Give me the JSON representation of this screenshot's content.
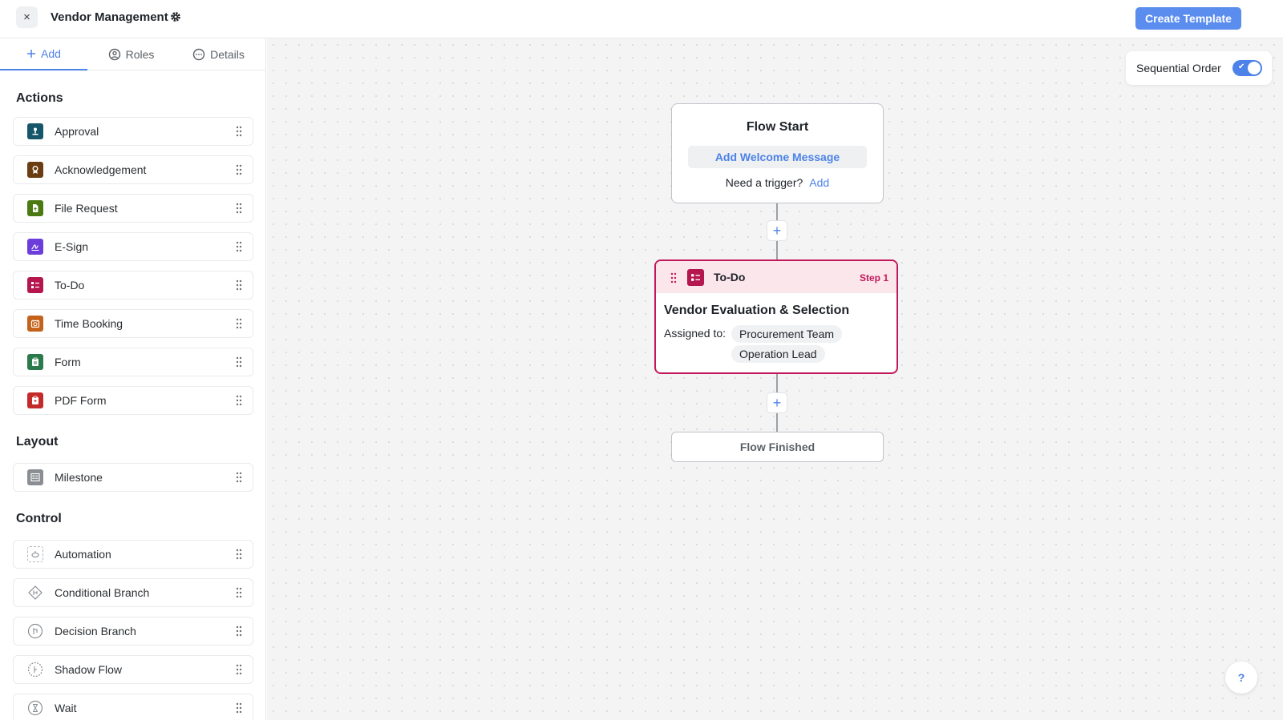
{
  "header": {
    "close_glyph": "×",
    "title": "Vendor Management",
    "gear_icon": "gear-icon",
    "create_label": "Create Template",
    "accent": "#5b8def"
  },
  "sidebar": {
    "tabs": [
      {
        "label": "Add",
        "icon": "plus-icon",
        "active": true
      },
      {
        "label": "Roles",
        "icon": "user-circle-icon",
        "active": false
      },
      {
        "label": "Details",
        "icon": "dots-circle-icon",
        "active": false
      }
    ],
    "sections": [
      {
        "title": "Actions"
      },
      {
        "title": "Layout"
      },
      {
        "title": "Control"
      }
    ],
    "items": [
      {
        "label": "Approval",
        "icon": "approval-icon",
        "color": "#16566b"
      },
      {
        "label": "Acknowledgement",
        "icon": "acknowledgement-icon",
        "color": "#6b3d12"
      },
      {
        "label": "File Request",
        "icon": "file-request-icon",
        "color": "#4b7a12"
      },
      {
        "label": "E-Sign",
        "icon": "esign-icon",
        "color": "#6b3ddb"
      },
      {
        "label": "To-Do",
        "icon": "todo-icon",
        "color": "#b5164e"
      },
      {
        "label": "Time Booking",
        "icon": "time-booking-icon",
        "color": "#c4621a"
      },
      {
        "label": "Form",
        "icon": "form-icon",
        "color": "#2b7a4b"
      },
      {
        "label": "PDF Form",
        "icon": "pdf-form-icon",
        "color": "#c42a2a"
      },
      {
        "label": "Milestone",
        "icon": "milestone-icon",
        "color": "#8a8e93"
      },
      {
        "label": "Automation",
        "icon": "automation-icon",
        "color": "#8a8e93"
      },
      {
        "label": "Conditional Branch",
        "icon": "conditional-branch-icon",
        "color": "#8a8e93"
      },
      {
        "label": "Decision Branch",
        "icon": "decision-branch-icon",
        "color": "#8a8e93"
      },
      {
        "label": "Shadow Flow",
        "icon": "shadow-flow-icon",
        "color": "#8a8e93"
      },
      {
        "label": "Wait",
        "icon": "hourglass-icon",
        "color": "#8a8e93"
      }
    ]
  },
  "canvas": {
    "sequential_label": "Sequential Order",
    "sequential_on": true,
    "flow_start": {
      "title": "Flow Start",
      "welcome_label": "Add Welcome Message",
      "trigger_text": "Need a trigger?",
      "trigger_link": "Add"
    },
    "plus_glyph": "+",
    "step": {
      "type_label": "To-Do",
      "step_label": "Step 1",
      "title": "Vendor Evaluation & Selection",
      "assigned_label": "Assigned to:",
      "assignees": [
        "Procurement Team",
        "Operation Lead"
      ],
      "accent": "#c2185b"
    },
    "flow_end": {
      "label": "Flow Finished"
    },
    "help_glyph": "?"
  }
}
